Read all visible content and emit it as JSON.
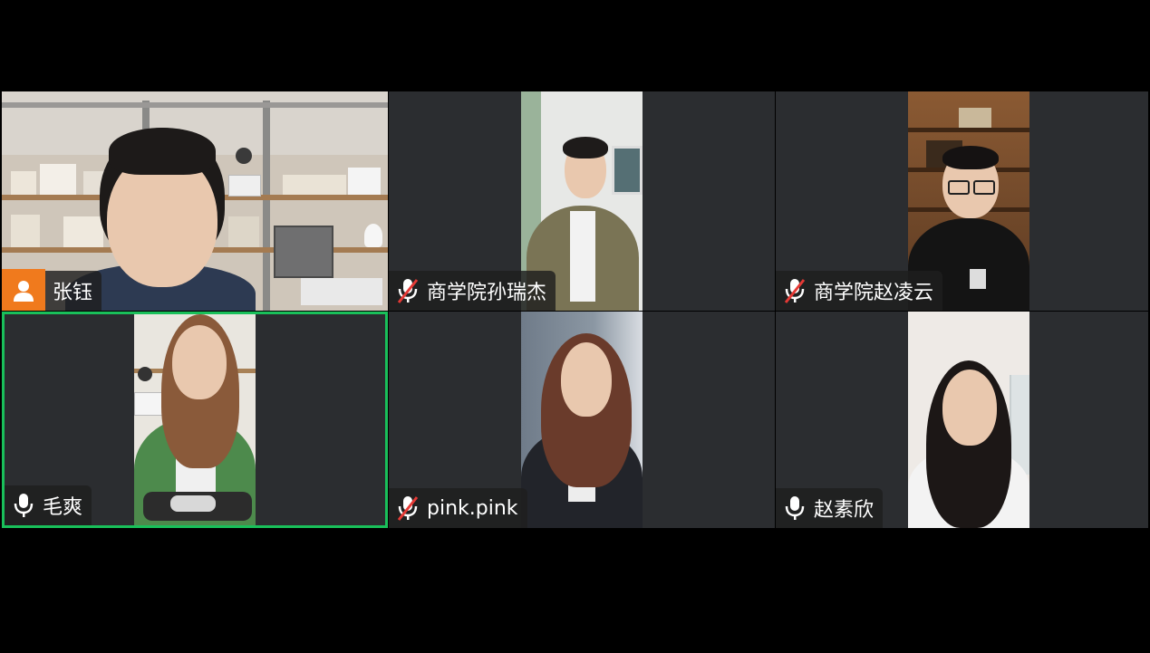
{
  "participants": [
    {
      "name": "张钰",
      "mic": "avatar",
      "active": false
    },
    {
      "name": "商学院孙瑞杰",
      "mic": "muted",
      "active": false
    },
    {
      "name": "商学院赵凌云",
      "mic": "muted",
      "active": false
    },
    {
      "name": "毛爽",
      "mic": "on",
      "active": true
    },
    {
      "name": "pink.pink",
      "mic": "muted",
      "active": false
    },
    {
      "name": "赵素欣",
      "mic": "on",
      "active": false
    }
  ],
  "colors": {
    "tile_bg": "#2b2d30",
    "active_speaker_border": "#19c05a",
    "avatar_badge": "#f07a1d",
    "mute_slash": "#e53935"
  },
  "icons": {
    "avatar": "person-icon",
    "mic_on": "microphone-icon",
    "mic_muted": "microphone-muted-icon"
  }
}
